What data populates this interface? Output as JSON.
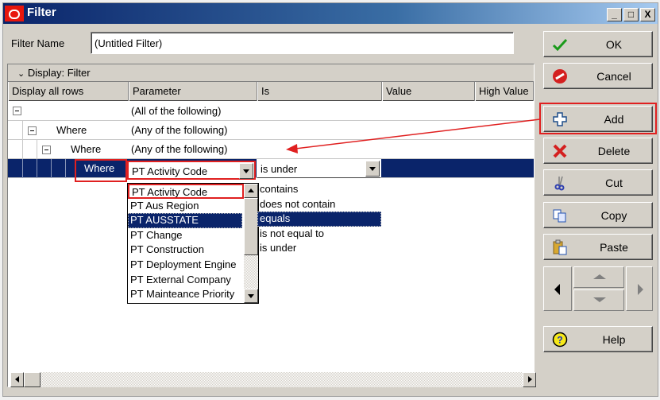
{
  "window": {
    "title": "Filter",
    "controls": [
      "_",
      "□",
      "X"
    ]
  },
  "filter_name": {
    "label": "Filter Name",
    "value": "(Untitled Filter)"
  },
  "grid": {
    "display_bar": "Display: Filter",
    "columns": [
      "Display all rows",
      "Parameter",
      "Is",
      "Value",
      "High Value"
    ],
    "rows": [
      {
        "level": 0,
        "label": "",
        "parameter": "(All of the following)"
      },
      {
        "level": 1,
        "label": "Where",
        "parameter": "(Any of the following)"
      },
      {
        "level": 2,
        "label": "Where",
        "parameter": "(Any of the following)"
      },
      {
        "level": 3,
        "label": "Where",
        "parameter": "PT Activity Code",
        "is": "is under",
        "selected": true
      }
    ]
  },
  "parameter_dropdown": {
    "items": [
      "PT Activity Code",
      "PT Aus Region",
      "PT AUSSTATE",
      "PT Change",
      "PT Construction",
      "PT Deployment Engine",
      "PT External Company",
      "PT Mainteance Priority"
    ],
    "selected": "PT AUSSTATE"
  },
  "is_dropdown": {
    "items": [
      "contains",
      "does not contain",
      "equals",
      "is not equal to",
      "is under"
    ],
    "selected": "equals"
  },
  "buttons": {
    "ok": "OK",
    "cancel": "Cancel",
    "add": "Add",
    "delete": "Delete",
    "cut": "Cut",
    "copy": "Copy",
    "paste": "Paste",
    "help": "Help"
  },
  "colors": {
    "selection": "#0a246a",
    "annotation": "#e02020"
  }
}
